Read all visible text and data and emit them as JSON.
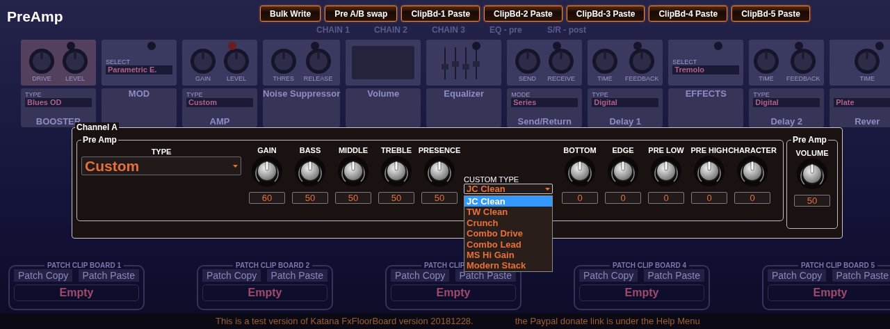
{
  "window": {
    "title": "PreAmp"
  },
  "toolbar": {
    "buttons": [
      "Bulk Write",
      "Pre A/B swap",
      "ClipBd-1 Paste",
      "ClipBd-2 Paste",
      "ClipBd-3 Paste",
      "ClipBd-4 Paste",
      "ClipBd-5 Paste"
    ]
  },
  "chain_labels": [
    "CHAIN 1",
    "CHAIN 2",
    "CHAIN 3",
    "EQ - pre",
    "S/R - post"
  ],
  "pedals": [
    {
      "kind": "knobs",
      "led_on": false,
      "knobs": [
        "DRIVE",
        "LEVEL"
      ],
      "select": {
        "label": "TYPE",
        "value": "Blues OD"
      },
      "name": "BOOSTER"
    },
    {
      "kind": "select",
      "led_on": false,
      "select": {
        "label": "SELECT",
        "value": "Parametric E."
      },
      "name": "MOD"
    },
    {
      "kind": "knobs",
      "led_on": true,
      "knobs": [
        "GAIN",
        "LEVEL"
      ],
      "select": {
        "label": "TYPE",
        "value": "Custom"
      },
      "name": "AMP"
    },
    {
      "kind": "knobs",
      "led_on": false,
      "knobs": [
        "THRES",
        "RELEASE"
      ],
      "name": "Noise Suppressor"
    },
    {
      "kind": "volume",
      "name": "Volume"
    },
    {
      "kind": "eq",
      "led_on": false,
      "name": "Equalizer"
    },
    {
      "kind": "knobs",
      "led_on": false,
      "knobs": [
        "SEND",
        "RECEIVE"
      ],
      "select": {
        "label": "MODE",
        "value": "Series"
      },
      "name": "Send/Return"
    },
    {
      "kind": "knobs",
      "led_on": false,
      "knobs": [
        "TIME",
        "FEEDBACK"
      ],
      "select": {
        "label": "TYPE",
        "value": "Digital"
      },
      "name": "Delay 1"
    },
    {
      "kind": "select",
      "led_on": false,
      "select": {
        "label": "SELECT",
        "value": "Tremolo"
      },
      "name": "EFFECTS"
    },
    {
      "kind": "knobs",
      "led_on": false,
      "knobs": [
        "TIME",
        "FEEDBACK"
      ],
      "select": {
        "label": "TYPE",
        "value": "Digital"
      },
      "name": "Delay 2"
    },
    {
      "kind": "knobs",
      "led_on": false,
      "knobs": [
        "TIME"
      ],
      "select": {
        "value": "Plate"
      },
      "name": "Rever"
    }
  ],
  "dialog": {
    "title": "Channel A",
    "preamp": {
      "title": "Pre Amp",
      "type": {
        "label": "TYPE",
        "value": "Custom"
      },
      "knobs_left": [
        {
          "label": "GAIN",
          "value": "60"
        },
        {
          "label": "BASS",
          "value": "50"
        },
        {
          "label": "MIDDLE",
          "value": "50"
        },
        {
          "label": "TREBLE",
          "value": "50"
        },
        {
          "label": "PRESENCE",
          "value": "50"
        }
      ],
      "custom_type": {
        "label": "CUSTOM TYPE",
        "value": "JC Clean",
        "expanded": true,
        "options": [
          {
            "label": "JC Clean",
            "selected": true
          },
          {
            "label": "TW Clean",
            "selected": false
          },
          {
            "label": "Crunch",
            "selected": false
          },
          {
            "label": "Combo Drive",
            "selected": false
          },
          {
            "label": "Combo Lead",
            "selected": false
          },
          {
            "label": "MS Hi Gain",
            "selected": false
          },
          {
            "label": "Modern Stack",
            "selected": false
          }
        ]
      },
      "knobs_right": [
        {
          "label": "BOTTOM",
          "value": "0"
        },
        {
          "label": "EDGE",
          "value": "0"
        },
        {
          "label": "PRE LOW",
          "value": "0"
        },
        {
          "label": "PRE HIGH",
          "value": "0"
        },
        {
          "label": "CHARACTER",
          "value": "0"
        }
      ]
    },
    "volume": {
      "title": "Pre Amp",
      "label": "VOLUME",
      "value": "50"
    }
  },
  "clipboards": [
    {
      "title": "PATCH CLIP BOARD 1",
      "copy": "Patch Copy",
      "paste": "Patch Paste",
      "content": "Empty"
    },
    {
      "title": "PATCH CLIP BOARD 2",
      "copy": "Patch Copy",
      "paste": "Patch Paste",
      "content": "Empty"
    },
    {
      "title": "PATCH CLIP",
      "copy": "Patch Copy",
      "paste": "Patch Paste",
      "content": "Empty"
    },
    {
      "title": "PATCH CLIP BOARD 4",
      "copy": "Patch Copy",
      "paste": "Patch Paste",
      "content": "Empty"
    },
    {
      "title": "PATCH CLIP BOARD 5",
      "copy": "Patch Copy",
      "paste": "Patch Paste",
      "content": "Empty"
    }
  ],
  "status_bar": {
    "messages": [
      "This is a test version of Katana FxFloorBoard version 20181228.",
      "the Paypal donate link is under the Help Menu"
    ]
  }
}
